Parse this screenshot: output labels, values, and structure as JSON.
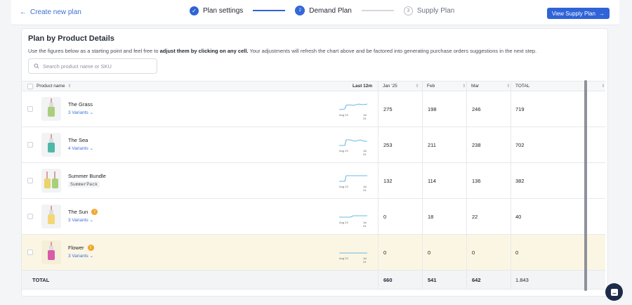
{
  "header": {
    "back_label": "Create new plan",
    "steps": [
      {
        "number": "1",
        "label": "Plan settings",
        "state": "done"
      },
      {
        "number": "2",
        "label": "Demand Plan",
        "state": "active"
      },
      {
        "number": "3",
        "label": "Supply Plan",
        "state": "todo"
      }
    ],
    "view_supply_label": "View Supply Plan"
  },
  "card": {
    "title": "Plan by Product Details",
    "subtitle_pre": "Use the figures below as a starting point and feel free to ",
    "subtitle_bold": "adjust them by clicking on any cell.",
    "subtitle_post": " Your adjustments will refresh the chart above and be factored into generating purchase orders suggestions in the next step.",
    "search_placeholder": "Search product name or SKU"
  },
  "table": {
    "columns": {
      "product": "Product name",
      "last12": "Last 12m",
      "jan": "Jan '25",
      "feb": "Feb",
      "mar": "Mar",
      "total": "TOTAL"
    },
    "spark_labels": {
      "start": "Aug 23",
      "end": "Jul 24"
    },
    "rows": [
      {
        "name": "The Grass",
        "variants": "3 Variants",
        "jan": "275",
        "feb": "198",
        "mar": "246",
        "total": "719",
        "thumb": "#a9cf7d",
        "warn": false
      },
      {
        "name": "The Sea",
        "variants": "4 Variants",
        "jan": "253",
        "feb": "211",
        "mar": "238",
        "total": "702",
        "thumb": "#4fb8a8",
        "warn": false
      },
      {
        "name": "Summer Bundle",
        "sku": "SummerPack",
        "jan": "132",
        "feb": "114",
        "mar": "136",
        "total": "382",
        "thumb": "#e9d36b",
        "warn": false
      },
      {
        "name": "The Sun",
        "variants": "3 Variants",
        "jan": "0",
        "feb": "18",
        "mar": "22",
        "total": "40",
        "thumb": "#f2d774",
        "warn": true
      },
      {
        "name": "Flower",
        "variants": "3 Variants",
        "jan": "0",
        "feb": "0",
        "mar": "0",
        "total": "0",
        "thumb": "#d95aa8",
        "warn": true
      }
    ],
    "totals": {
      "label": "TOTAL",
      "jan": "660",
      "feb": "541",
      "mar": "642",
      "total": "1.843"
    }
  },
  "colors": {
    "accent": "#2f63d7",
    "highlight_row": "#fbf6e4",
    "warning": "#f0a52a",
    "sparkline": "#3ba3e0"
  }
}
